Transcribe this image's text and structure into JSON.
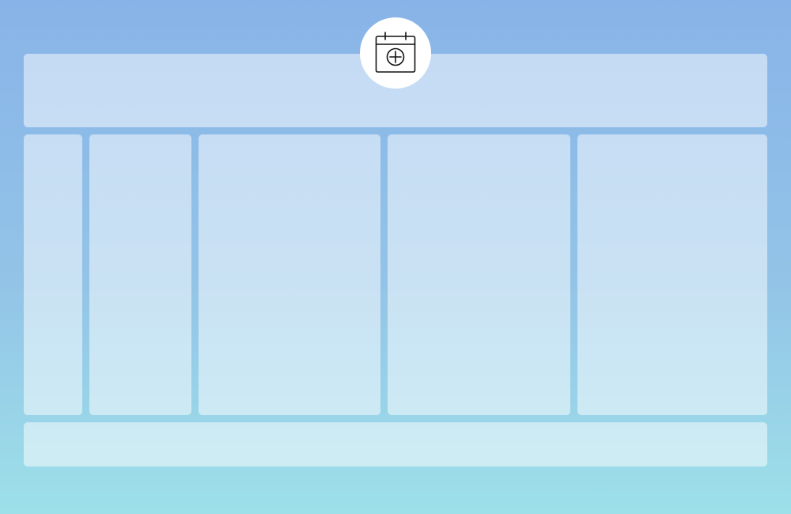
{
  "badge": {
    "icon": "calendar-add-icon",
    "background": "#ffffff",
    "stroke": "#111111"
  },
  "colors": {
    "background_top": "#88b3e8",
    "background_bottom": "#9de0e9",
    "panel_fill": "rgba(255,255,255,0.5)"
  }
}
